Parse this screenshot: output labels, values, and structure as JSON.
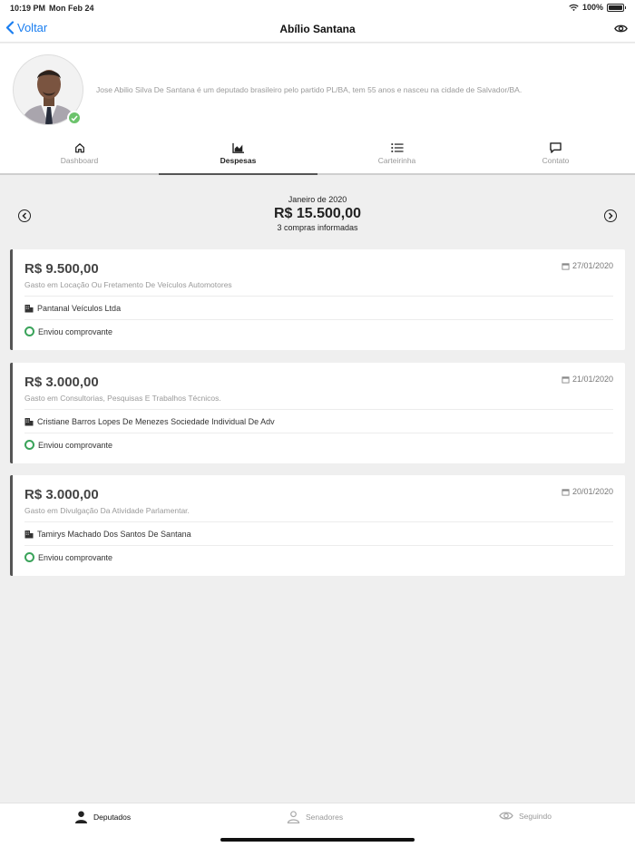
{
  "status": {
    "time": "10:19 PM",
    "date": "Mon Feb 24",
    "battery": "100%"
  },
  "nav": {
    "back_label": "Voltar",
    "title": "Abílio Santana"
  },
  "profile": {
    "bio": "Jose Abilio Silva De Santana é um deputado brasileiro pelo partido PL/BA, tem 55 anos e nasceu na cidade de Salvador/BA."
  },
  "tabs": [
    {
      "label": "Dashboard",
      "icon": "home-icon",
      "active": false
    },
    {
      "label": "Despesas",
      "icon": "chart-icon",
      "active": true
    },
    {
      "label": "Carteirinha",
      "icon": "list-icon",
      "active": false
    },
    {
      "label": "Contato",
      "icon": "chat-icon",
      "active": false
    }
  ],
  "summary": {
    "month": "Janeiro de 2020",
    "total": "R$ 15.500,00",
    "count": "3 compras informadas"
  },
  "expenses": [
    {
      "amount": "R$ 9.500,00",
      "date": "27/01/2020",
      "description": "Gasto em Locação Ou Fretamento De Veículos Automotores",
      "supplier": "Pantanal Veículos Ltda",
      "status": "Enviou comprovante"
    },
    {
      "amount": "R$ 3.000,00",
      "date": "21/01/2020",
      "description": "Gasto em Consultorias, Pesquisas E Trabalhos Técnicos.",
      "supplier": "Cristiane Barros Lopes De Menezes Sociedade Individual De Adv",
      "status": "Enviou comprovante"
    },
    {
      "amount": "R$ 3.000,00",
      "date": "20/01/2020",
      "description": "Gasto em Divulgação Da Atividade Parlamentar.",
      "supplier": "Tamirys Machado Dos Santos De Santana",
      "status": "Enviou comprovante"
    }
  ],
  "bottom_tabs": [
    {
      "label": "Deputados",
      "icon": "person-icon",
      "active": true
    },
    {
      "label": "Senadores",
      "icon": "person-outline-icon",
      "active": false
    },
    {
      "label": "Seguindo",
      "icon": "eye-icon",
      "active": false
    }
  ],
  "colors": {
    "accent": "#1a7ef0",
    "success": "#3aa35a",
    "verified": "#6cc36c"
  }
}
